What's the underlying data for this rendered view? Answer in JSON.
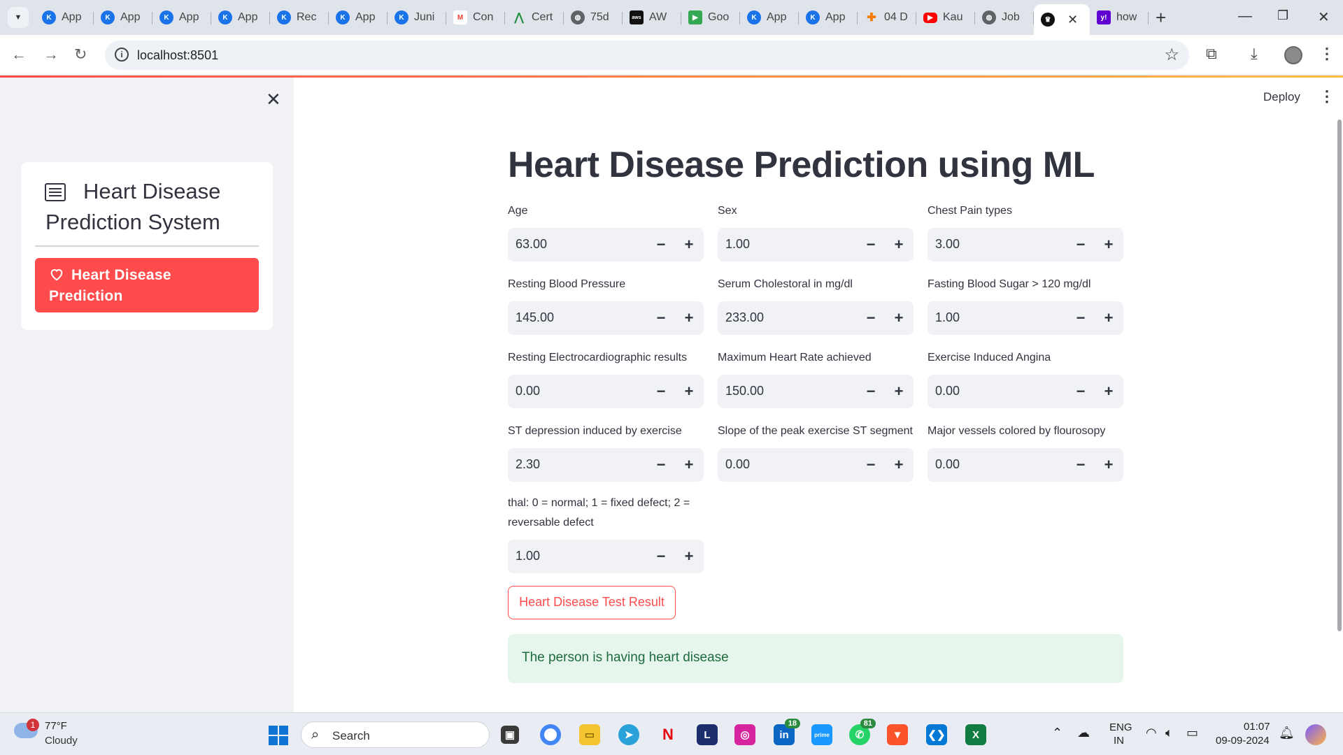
{
  "browser": {
    "tabs": [
      {
        "label": "App",
        "color": "#1a73e8",
        "icon": "k-app-icon"
      },
      {
        "label": "App",
        "color": "#1a73e8",
        "icon": "k-app-icon"
      },
      {
        "label": "App",
        "color": "#1a73e8",
        "icon": "k-app-icon"
      },
      {
        "label": "App",
        "color": "#1a73e8",
        "icon": "k-app-icon"
      },
      {
        "label": "Rec",
        "color": "#1a73e8",
        "icon": "k-app-icon"
      },
      {
        "label": "App",
        "color": "#1a73e8",
        "icon": "k-app-icon"
      },
      {
        "label": "Juni",
        "color": "#1a73e8",
        "icon": "k-app-icon"
      },
      {
        "label": "Con",
        "color": "#ea4335",
        "icon": "gmail-icon"
      },
      {
        "label": "Cert",
        "color": "#1e8e3e",
        "icon": "cert-icon"
      },
      {
        "label": "75d",
        "color": "#5f6368",
        "icon": "globe-icon"
      },
      {
        "label": "AW",
        "color": "#111111",
        "icon": "aws-icon"
      },
      {
        "label": "Goo",
        "color": "#34a853",
        "icon": "google-meet-icon"
      },
      {
        "label": "App",
        "color": "#1a73e8",
        "icon": "k-app-icon"
      },
      {
        "label": "App",
        "color": "#1a73e8",
        "icon": "k-app-icon"
      },
      {
        "label": "04 D",
        "color": "#f57c00",
        "icon": "puzzle-icon"
      },
      {
        "label": "Kau",
        "color": "#ff0000",
        "icon": "youtube-icon"
      },
      {
        "label": "Job",
        "color": "#5f6368",
        "icon": "globe-icon"
      },
      {
        "label": "",
        "color": "#111111",
        "icon": "streamlit-icon",
        "active": true
      },
      {
        "label": "how",
        "color": "#6001d2",
        "icon": "yahoo-icon"
      }
    ],
    "url": "localhost:8501"
  },
  "sidebar": {
    "menu_title": "Heart Disease Prediction System",
    "menu_item": "Heart Disease Prediction"
  },
  "main": {
    "deploy": "Deploy",
    "title": "Heart Disease Prediction using ML",
    "fields": [
      {
        "label": "Age",
        "value": "63.00"
      },
      {
        "label": "Sex",
        "value": "1.00"
      },
      {
        "label": "Chest Pain types",
        "value": "3.00"
      },
      {
        "label": "Resting Blood Pressure",
        "value": "145.00"
      },
      {
        "label": "Serum Cholestoral in mg/dl",
        "value": "233.00"
      },
      {
        "label": "Fasting Blood Sugar > 120 mg/dl",
        "value": "1.00"
      },
      {
        "label": "Resting Electrocardiographic results",
        "value": "0.00"
      },
      {
        "label": "Maximum Heart Rate achieved",
        "value": "150.00"
      },
      {
        "label": "Exercise Induced Angina",
        "value": "0.00"
      },
      {
        "label": "ST depression induced by exercise",
        "value": "2.30"
      },
      {
        "label": "Slope of the peak exercise ST segment",
        "value": "0.00"
      },
      {
        "label": "Major vessels colored by flourosopy",
        "value": "0.00"
      },
      {
        "label": "thal: 0 = normal; 1 = fixed defect; 2 = reversable defect",
        "value": "1.00"
      }
    ],
    "button_label": "Heart Disease Test Result",
    "result": "The person is having heart disease"
  },
  "taskbar": {
    "weather_badge": "1",
    "weather_temp": "77°F",
    "weather_desc": "Cloudy",
    "search_label": "Search",
    "linkedin_badge": "18",
    "whatsapp_badge": "81",
    "lang_1": "ENG",
    "lang_2": "IN",
    "time": "01:07",
    "date": "09-09-2024"
  }
}
